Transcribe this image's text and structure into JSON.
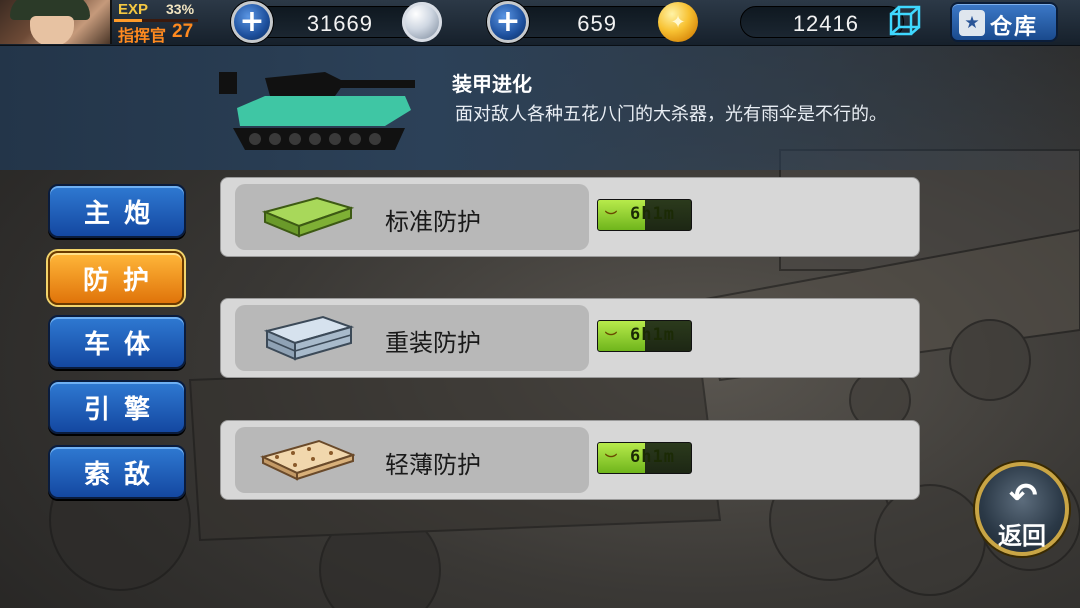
{
  "header": {
    "exp_label": "EXP",
    "exp_percent": "33%",
    "exp_fraction": 0.33,
    "rank_label": "指挥官",
    "rank_level": "27",
    "silver": {
      "value": "31669"
    },
    "gold": {
      "value": "659"
    },
    "parts": {
      "value": "12416"
    },
    "warehouse_label": "仓库"
  },
  "info": {
    "title": "装甲进化",
    "description": "面对敌人各种五花八门的大杀器，光有雨伞是不行的。"
  },
  "tabs": [
    {
      "label": "主炮",
      "active": false
    },
    {
      "label": "防护",
      "active": true
    },
    {
      "label": "车体",
      "active": false
    },
    {
      "label": "引擎",
      "active": false
    },
    {
      "label": "索敌",
      "active": false
    }
  ],
  "armors": [
    {
      "name": "标准防护",
      "timer": "6h1m",
      "progress": 0.5,
      "plate_color": "#8cbf3a"
    },
    {
      "name": "重装防护",
      "timer": "6h1m",
      "progress": 0.5,
      "plate_color": "#9eb4c8"
    },
    {
      "name": "轻薄防护",
      "timer": "6h1m",
      "progress": 0.5,
      "plate_color": "#e8c79a"
    }
  ],
  "return_label": "返回",
  "colors": {
    "tab_blue": "#1d5fb8",
    "tab_active": "#f39a1e",
    "timer_green": "#8fd12e",
    "tank_teal": "#3fc6a4"
  }
}
